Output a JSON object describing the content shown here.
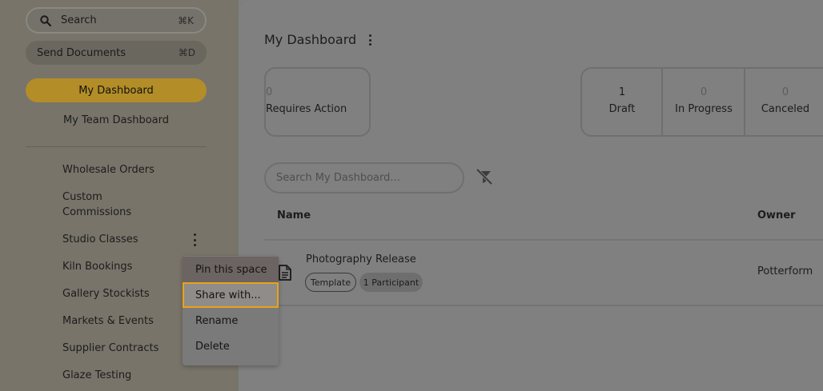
{
  "sidebar": {
    "search_label": "Search",
    "search_shortcut": "⌘K",
    "send_label": "Send Documents",
    "send_shortcut": "⌘D",
    "my_dashboard": "My Dashboard",
    "team_dashboard": "My Team Dashboard",
    "spaces": [
      "Wholesale Orders",
      "Custom Commissions",
      "Studio Classes",
      "Kiln Bookings",
      "Gallery Stockists",
      "Markets & Events",
      "Supplier Contracts",
      "Glaze Testing"
    ]
  },
  "context_menu": {
    "items": [
      "Pin this space",
      "Share with...",
      "Rename",
      "Delete"
    ]
  },
  "main": {
    "title": "My Dashboard",
    "stats": [
      {
        "count": "0",
        "label": "Requires Action"
      },
      {
        "count": "1",
        "label": "Draft"
      },
      {
        "count": "0",
        "label": "In Progress"
      },
      {
        "count": "0",
        "label": "Canceled"
      }
    ],
    "search_placeholder": "Search My Dashboard...",
    "columns": {
      "name": "Name",
      "owner": "Owner"
    },
    "rows": [
      {
        "name": "Photography Release",
        "tags": [
          "Template",
          "1 Participant"
        ],
        "owner": "Potterform"
      }
    ]
  },
  "colors": {
    "accent": "#b38d27",
    "highlight_border": "#e8a317"
  }
}
